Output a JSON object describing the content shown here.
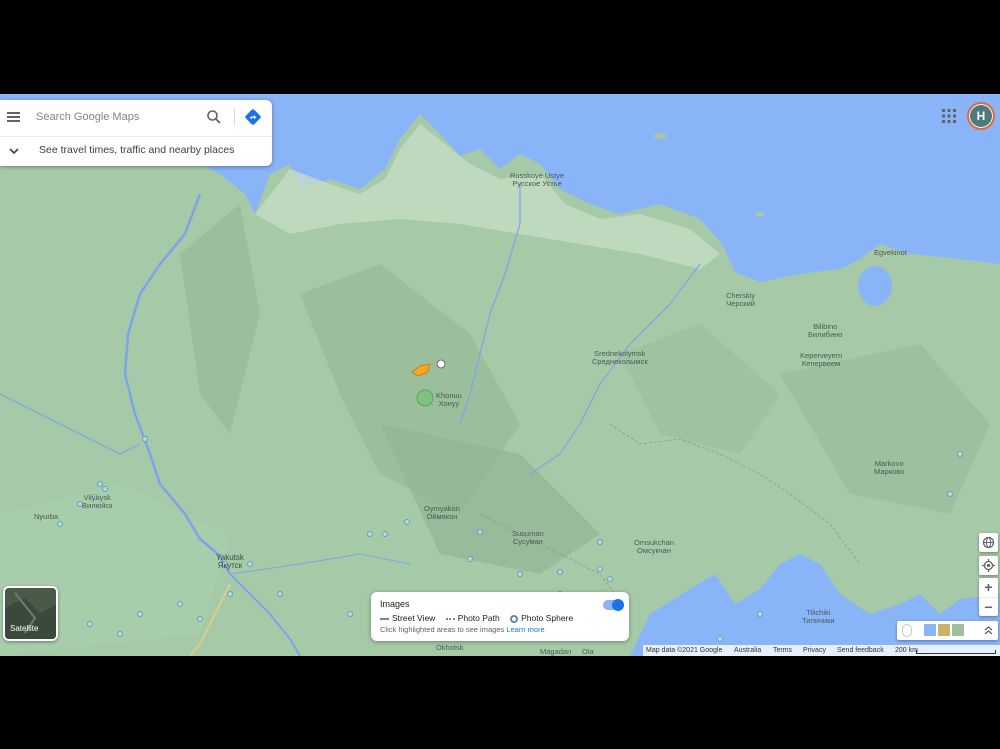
{
  "search": {
    "placeholder": "Search Google Maps"
  },
  "travel_row": {
    "label": "See travel times, traffic and nearby places"
  },
  "account": {
    "initial": "H"
  },
  "satellite": {
    "label": "Satellite"
  },
  "images_panel": {
    "title": "Images",
    "legend": [
      "Street View",
      "Photo Path",
      "Photo Sphere"
    ],
    "hint": "Click highlighted areas to see images",
    "learn_more": "Learn more"
  },
  "attribution": {
    "map_data": "Map data ©2021 Google",
    "region": "Australia",
    "terms": "Terms",
    "privacy": "Privacy",
    "feedback": "Send feedback",
    "scale": "200 km"
  },
  "places": [
    {
      "latin": "Russkoye Ustye",
      "cyrillic": "Русское Устье"
    },
    {
      "latin": "Cherskiy",
      "cyrillic": "Черский"
    },
    {
      "latin": "Bilibino",
      "cyrillic": "Билибино"
    },
    {
      "latin": "Keperveyem",
      "cyrillic": "Кепервеем"
    },
    {
      "latin": "Srednekolymsk",
      "cyrillic": "Среднеколымск"
    },
    {
      "latin": "Khonuu",
      "cyrillic": "Хонуу"
    },
    {
      "latin": "Vilyuysk",
      "cyrillic": "Вилюйск"
    },
    {
      "latin": "Yakutsk",
      "cyrillic": "Якутск"
    },
    {
      "latin": "Oymyakon",
      "cyrillic": "Оймякон"
    },
    {
      "latin": "Susuman",
      "cyrillic": "Сусуман"
    },
    {
      "latin": "Omsukchan",
      "cyrillic": "Омсукчан"
    },
    {
      "latin": "Markovo",
      "cyrillic": "Марково"
    },
    {
      "latin": "Tilichiki",
      "cyrillic": "Тиличики"
    },
    {
      "latin": "Okhotsk",
      "cyrillic": ""
    },
    {
      "latin": "Magadan",
      "cyrillic": ""
    },
    {
      "latin": "Ola",
      "cyrillic": ""
    },
    {
      "latin": "Egvekinot",
      "cyrillic": ""
    },
    {
      "latin": "Nyurba",
      "cyrillic": ""
    }
  ],
  "colors": {
    "land": "#a3c8a6",
    "water": "#8ab4f8",
    "accent": "#1a73e8",
    "avatar_ring": "#e46a3a"
  },
  "icons": [
    "menu-icon",
    "search-icon",
    "directions-icon",
    "chevron-down-icon",
    "apps-icon",
    "globe-icon",
    "my-location-icon",
    "zoom-in-icon",
    "zoom-out-icon",
    "pegman-icon",
    "expand-icon"
  ]
}
